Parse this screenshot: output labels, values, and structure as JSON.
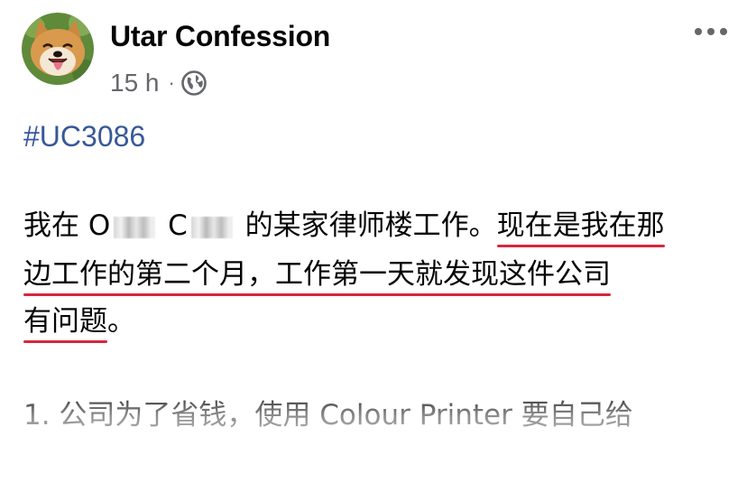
{
  "post": {
    "author": "Utar Confession",
    "time": "15 h",
    "separator": "·",
    "privacy_icon": "globe-icon",
    "more_icon": "more-options-icon",
    "avatar_icon": "shiba-dog-avatar",
    "hashtag": "#UC3086",
    "body": {
      "line1": {
        "part1": "我在 O",
        "part2": " C",
        "part3": " 的某家律师楼工作。",
        "highlight": "现在是我在那"
      },
      "line2": {
        "highlight": "边工作的第二个月，工作第一天就发现这件公司"
      },
      "line3": {
        "highlight": "有问题",
        "suffix": "。"
      },
      "line4": "1. 公司为了省钱，使用 Colour Printer 要自己给"
    }
  },
  "colors": {
    "link": "#385898",
    "underline": "#d7263d",
    "meta": "#65676b"
  }
}
